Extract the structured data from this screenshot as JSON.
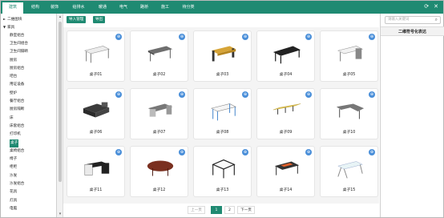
{
  "nav": {
    "tabs": [
      "建筑",
      "结构",
      "装饰",
      "给排水",
      "暖通",
      "电气",
      "路桥",
      "施工",
      "待分类"
    ],
    "active_index": 0
  },
  "sidebar": {
    "items": [
      {
        "label": "二维图块",
        "level": 0,
        "arrow": "►"
      },
      {
        "label": "家具",
        "level": 0,
        "arrow": "▼"
      },
      {
        "label": "静室组合",
        "level": 1
      },
      {
        "label": "卫生间组合",
        "level": 1
      },
      {
        "label": "卫生间隔断",
        "level": 1
      },
      {
        "label": "厨房",
        "level": 1
      },
      {
        "label": "厨房组合",
        "level": 1
      },
      {
        "label": "吧台",
        "level": 1
      },
      {
        "label": "用证设备",
        "level": 1
      },
      {
        "label": "壁炉",
        "level": 1
      },
      {
        "label": "餐厅组合",
        "level": 1
      },
      {
        "label": "厨房隔断",
        "level": 1
      },
      {
        "label": "床",
        "level": 1
      },
      {
        "label": "床套组合",
        "level": 1
      },
      {
        "label": "打印机",
        "level": 1
      },
      {
        "label": "桌子",
        "level": 1,
        "selected": true
      },
      {
        "label": "桌椅组合",
        "level": 1
      },
      {
        "label": "椅子",
        "level": 1
      },
      {
        "label": "柜柜",
        "level": 1
      },
      {
        "label": "沙发",
        "level": 1
      },
      {
        "label": "沙发组合",
        "level": 1
      },
      {
        "label": "花具",
        "level": 1
      },
      {
        "label": "灯具",
        "level": 1
      },
      {
        "label": "电脑",
        "level": 1
      }
    ]
  },
  "toolbar": {
    "import_label": "导入管理",
    "export_label": "导出"
  },
  "cards": [
    {
      "label": "桌子01"
    },
    {
      "label": "桌子02"
    },
    {
      "label": "桌子03"
    },
    {
      "label": "桌子04"
    },
    {
      "label": "桌子05"
    },
    {
      "label": "桌子06"
    },
    {
      "label": "桌子07"
    },
    {
      "label": "桌子08"
    },
    {
      "label": "桌子09"
    },
    {
      "label": "桌子10"
    },
    {
      "label": "桌子11"
    },
    {
      "label": "桌子12"
    },
    {
      "label": "桌子13"
    },
    {
      "label": "桌子14"
    },
    {
      "label": "桌子15"
    }
  ],
  "badge_glyph": "⊕",
  "pagination": {
    "prev": "上一页",
    "pages": [
      "1",
      "2"
    ],
    "current": "1",
    "next": "下一页"
  },
  "right": {
    "search_placeholder": "请输入关键词",
    "panel_title": "二维符号化表达"
  },
  "colors": {
    "accent": "#1f8a72",
    "badge": "#4a8fd9"
  }
}
